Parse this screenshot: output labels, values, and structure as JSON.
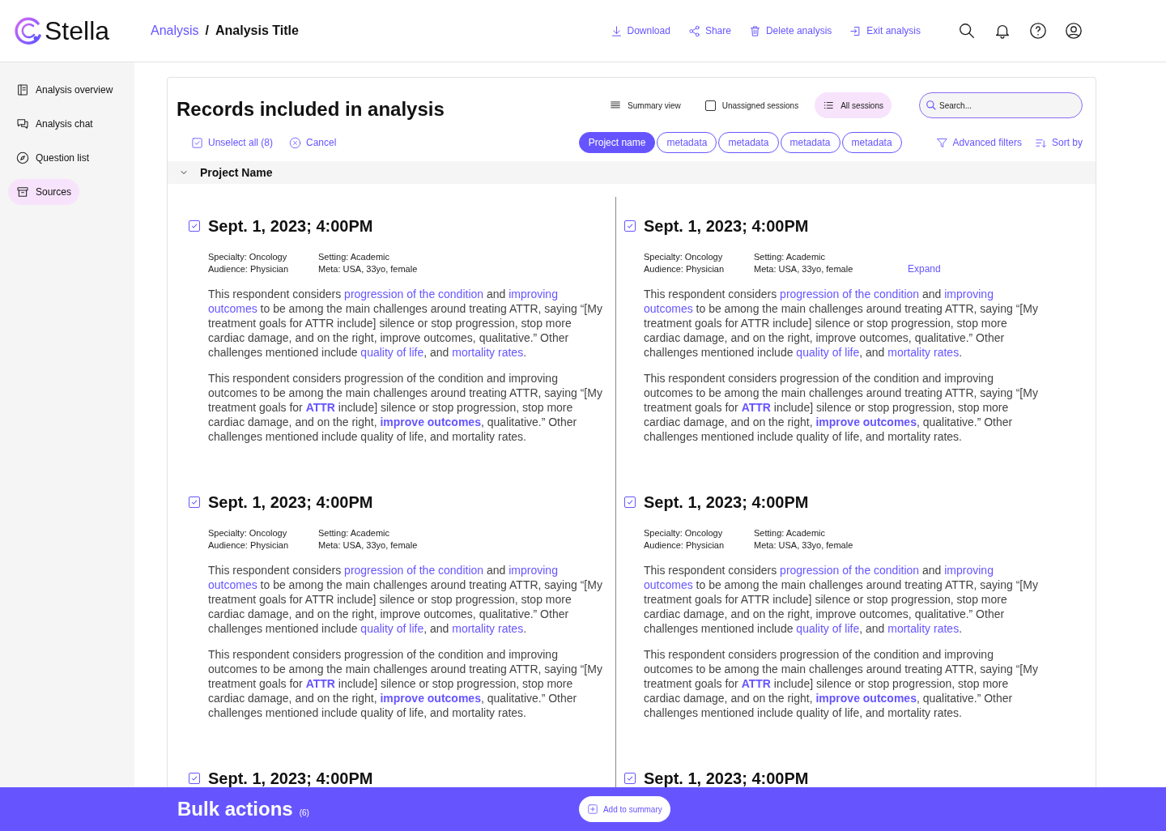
{
  "header": {
    "brand": "Stella",
    "breadcrumb": [
      {
        "text": "Analysis",
        "kind": "link"
      },
      {
        "text": "/",
        "kind": "separator"
      },
      {
        "text": "Analysis Title",
        "kind": "current"
      }
    ],
    "actions": [
      {
        "label": "Download"
      },
      {
        "label": "Share"
      },
      {
        "label": "Delete analysis"
      },
      {
        "label": "Exit analysis"
      }
    ]
  },
  "sidebar": {
    "items": [
      {
        "label": "Analysis overview",
        "selected": false
      },
      {
        "label": "Analysis chat",
        "selected": false
      },
      {
        "label": "Question list",
        "selected": false
      },
      {
        "label": "Sources",
        "selected": true
      }
    ]
  },
  "panel": {
    "title": "Records included in analysis",
    "views": [
      {
        "label": "Summary view",
        "kind": "lines",
        "selected": false
      },
      {
        "label": "Unassigned sessions",
        "kind": "checkbox",
        "selected": false
      },
      {
        "label": "All sessions",
        "kind": "list",
        "selected": true
      }
    ],
    "search": {
      "placeholder": "Search..."
    },
    "selection_actions": [
      {
        "label": "Unselect all (8)"
      },
      {
        "label": "Cancel"
      }
    ],
    "chips": [
      {
        "label": "Project name",
        "selected": true
      },
      {
        "label": "metadata",
        "selected": false
      },
      {
        "label": "metadata",
        "selected": false
      },
      {
        "label": "metadata",
        "selected": false
      },
      {
        "label": "metadata",
        "selected": false
      }
    ],
    "tools": [
      {
        "label": "Advanced filters"
      },
      {
        "label": "Sort by"
      }
    ],
    "group": {
      "label": "Project Name",
      "expanded": true
    },
    "records": [
      {
        "title": "Sept. 1, 2023; 4:00PM",
        "checked": true,
        "meta": [
          "Specialty: Oncology",
          "Audience: Physician",
          "Setting: Academic",
          "Meta: USA, 33yo, female"
        ],
        "paragraphs": [
          [
            {
              "text": "This respondent considers ",
              "kind": "plain"
            },
            {
              "text": "progression of the condition",
              "kind": "link"
            },
            {
              "text": " and ",
              "kind": "plain"
            },
            {
              "text": "improving outcomes",
              "kind": "link"
            },
            {
              "text": " to be among the main challenges around treating ATTR, saying “[My treatment goals for ATTR include] silence or stop progression, stop more cardiac damage, and on the right, improve outcomes, qualitative.” Other challenges mentioned include ",
              "kind": "plain"
            },
            {
              "text": "quality of life",
              "kind": "link"
            },
            {
              "text": ", and ",
              "kind": "plain"
            },
            {
              "text": "mortality rates",
              "kind": "link"
            },
            {
              "text": ".",
              "kind": "plain"
            }
          ],
          [
            {
              "text": "This respondent considers progression of the condition and improving outcomes to be among the main challenges around treating ATTR, saying “[My treatment goals for ",
              "kind": "plain"
            },
            {
              "text": "ATTR",
              "kind": "strong"
            },
            {
              "text": " include] silence or stop progression, stop more cardiac damage, and on the right, ",
              "kind": "plain"
            },
            {
              "text": "improve outcomes",
              "kind": "strong"
            },
            {
              "text": ", qualitative.” Other challenges mentioned include quality of life, and mortality rates.",
              "kind": "plain"
            }
          ]
        ]
      },
      {
        "title": "Sept. 1, 2023; 4:00PM",
        "checked": true,
        "meta": [
          "Specialty: Oncology",
          "Audience: Physician",
          "Setting: Academic",
          "Meta: USA, 33yo, female"
        ],
        "expand": "Expand",
        "paragraphs": [
          [
            {
              "text": "This respondent considers ",
              "kind": "plain"
            },
            {
              "text": "progression of the condition",
              "kind": "link"
            },
            {
              "text": " and ",
              "kind": "plain"
            },
            {
              "text": "improving outcomes",
              "kind": "link"
            },
            {
              "text": " to be among the main challenges around treating ATTR, saying “[My treatment goals for ATTR include] silence or stop progression, stop more cardiac damage, and on the right, improve outcomes, qualitative.” Other challenges mentioned include ",
              "kind": "plain"
            },
            {
              "text": "quality of life",
              "kind": "link"
            },
            {
              "text": ", and ",
              "kind": "plain"
            },
            {
              "text": "mortality rates",
              "kind": "link"
            },
            {
              "text": ".",
              "kind": "plain"
            }
          ],
          [
            {
              "text": "This respondent considers progression of the condition and improving outcomes to be among the main challenges around treating ATTR, saying “[My treatment goals for ",
              "kind": "plain"
            },
            {
              "text": "ATTR",
              "kind": "strong"
            },
            {
              "text": " include] silence or stop progression, stop more cardiac damage, and on the right, ",
              "kind": "plain"
            },
            {
              "text": "improve outcomes",
              "kind": "strong"
            },
            {
              "text": ", qualitative.” Other challenges mentioned include quality of life, and mortality rates.",
              "kind": "plain"
            }
          ]
        ]
      },
      {
        "title": "Sept. 1, 2023; 4:00PM",
        "checked": true,
        "meta": [
          "Specialty: Oncology",
          "Audience: Physician",
          "Setting: Academic",
          "Meta: USA, 33yo, female"
        ],
        "paragraphs": [
          [
            {
              "text": "This respondent considers ",
              "kind": "plain"
            },
            {
              "text": "progression of the condition",
              "kind": "link"
            },
            {
              "text": " and ",
              "kind": "plain"
            },
            {
              "text": "improving outcomes",
              "kind": "link"
            },
            {
              "text": " to be among the main challenges around treating ATTR, saying “[My treatment goals for ATTR include] silence or stop progression, stop more cardiac damage, and on the right, improve outcomes, qualitative.” Other challenges mentioned include ",
              "kind": "plain"
            },
            {
              "text": "quality of life",
              "kind": "link"
            },
            {
              "text": ", and ",
              "kind": "plain"
            },
            {
              "text": "mortality rates",
              "kind": "link"
            },
            {
              "text": ".",
              "kind": "plain"
            }
          ],
          [
            {
              "text": "This respondent considers progression of the condition and improving outcomes to be among the main challenges around treating ATTR, saying “[My treatment goals for ",
              "kind": "plain"
            },
            {
              "text": "ATTR",
              "kind": "strong"
            },
            {
              "text": " include] silence or stop progression, stop more cardiac damage, and on the right, ",
              "kind": "plain"
            },
            {
              "text": "improve outcomes",
              "kind": "strong"
            },
            {
              "text": ", qualitative.” Other challenges mentioned include quality of life, and mortality rates.",
              "kind": "plain"
            }
          ]
        ]
      },
      {
        "title": "Sept. 1, 2023; 4:00PM",
        "checked": true,
        "meta": [
          "Specialty: Oncology",
          "Audience: Physician",
          "Setting: Academic",
          "Meta: USA, 33yo, female"
        ],
        "paragraphs": [
          [
            {
              "text": "This respondent considers ",
              "kind": "plain"
            },
            {
              "text": "progression of the condition",
              "kind": "link"
            },
            {
              "text": " and ",
              "kind": "plain"
            },
            {
              "text": "improving outcomes",
              "kind": "link"
            },
            {
              "text": " to be among the main challenges around treating ATTR, saying “[My treatment goals for ATTR include] silence or stop progression, stop more cardiac damage, and on the right, improve outcomes, qualitative.” Other challenges mentioned include ",
              "kind": "plain"
            },
            {
              "text": "quality of life",
              "kind": "link"
            },
            {
              "text": ", and ",
              "kind": "plain"
            },
            {
              "text": "mortality rates",
              "kind": "link"
            },
            {
              "text": ".",
              "kind": "plain"
            }
          ],
          [
            {
              "text": "This respondent considers progression of the condition and improving outcomes to be among the main challenges around treating ATTR, saying “[My treatment goals for ",
              "kind": "plain"
            },
            {
              "text": "ATTR",
              "kind": "strong"
            },
            {
              "text": " include] silence or stop progression, stop more cardiac damage, and on the right, ",
              "kind": "plain"
            },
            {
              "text": "improve outcomes",
              "kind": "strong"
            },
            {
              "text": ", qualitative.” Other challenges mentioned include quality of life, and mortality rates.",
              "kind": "plain"
            }
          ]
        ]
      },
      {
        "title": "Sept. 1, 2023; 4:00PM",
        "checked": true
      },
      {
        "title": "Sept. 1, 2023; 4:00PM",
        "checked": true
      }
    ]
  },
  "bulk_bar": {
    "title": "Bulk actions",
    "count": "(6)",
    "button": "Add to summary"
  }
}
